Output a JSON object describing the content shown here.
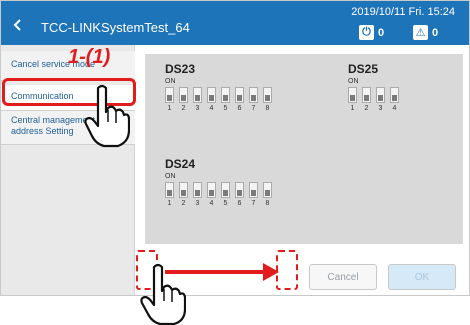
{
  "header": {
    "title": "TCC-LINKSystemTest_64",
    "datetime": "2019/10/11 Fri. 15:24",
    "power_count": "0",
    "alert_count": "0"
  },
  "sidebar": {
    "items": [
      {
        "label": "Cancel service mode"
      },
      {
        "label": "Communication"
      },
      {
        "label": "Central management address Setting"
      }
    ]
  },
  "switches": {
    "on_label": "ON",
    "ds23": {
      "name": "DS23",
      "numbers": [
        "1",
        "2",
        "3",
        "4",
        "5",
        "6",
        "7",
        "8"
      ]
    },
    "ds25": {
      "name": "DS25",
      "numbers": [
        "1",
        "2",
        "3",
        "4"
      ]
    },
    "ds24": {
      "name": "DS24",
      "numbers": [
        "1",
        "2",
        "3",
        "4",
        "5",
        "6",
        "7",
        "8"
      ]
    }
  },
  "buttons": {
    "cancel": "Cancel",
    "ok": "OK"
  },
  "annotation": {
    "step": "1-(1)"
  },
  "colors": {
    "header": "#1e74b8",
    "accent_red": "#e21b1b",
    "panel": "#d9d9d9"
  }
}
